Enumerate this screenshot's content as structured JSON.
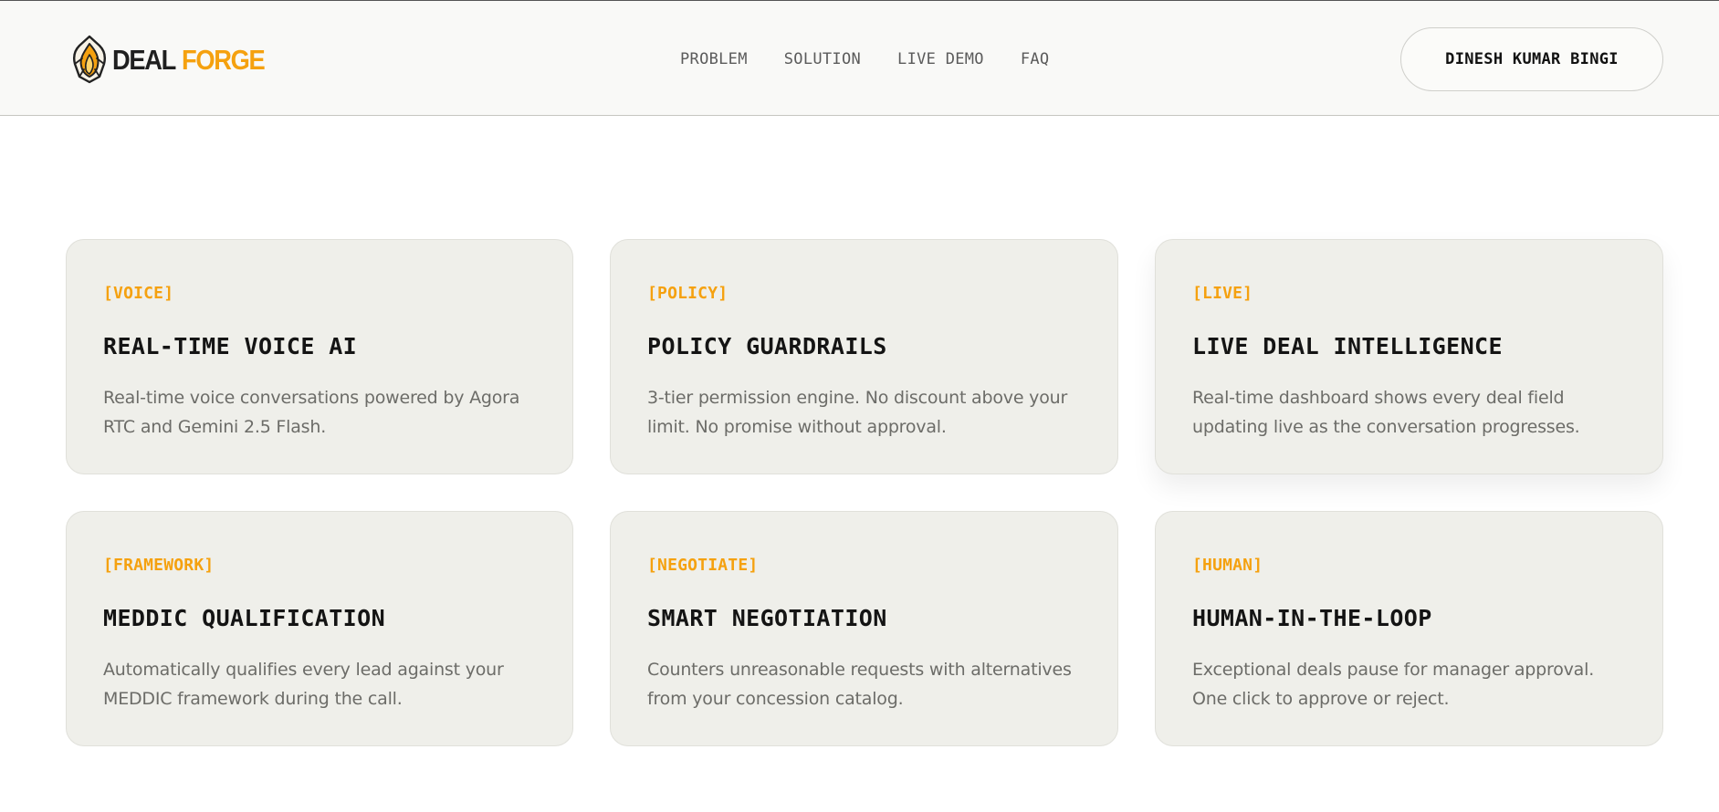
{
  "brand": {
    "word1": "DEAL",
    "word2": "FORGE",
    "logo_icon": "flame-shield-icon",
    "accent_color": "#f5a10f"
  },
  "nav": {
    "items": [
      {
        "label": "PROBLEM"
      },
      {
        "label": "SOLUTION"
      },
      {
        "label": "LIVE DEMO"
      },
      {
        "label": "FAQ"
      }
    ]
  },
  "user": {
    "name": "DINESH KUMAR BINGI"
  },
  "features": [
    {
      "tag": "[VOICE]",
      "title": "REAL-TIME VOICE AI",
      "description": "Real-time voice conversations powered by Agora RTC and Gemini 2.5 Flash."
    },
    {
      "tag": "[POLICY]",
      "title": "POLICY GUARDRAILS",
      "description": "3-tier permission engine. No discount above your limit. No promise without approval."
    },
    {
      "tag": "[LIVE]",
      "title": "LIVE DEAL INTELLIGENCE",
      "description": "Real-time dashboard shows every deal field updating live as the conversation progresses."
    },
    {
      "tag": "[FRAMEWORK]",
      "title": "MEDDIC QUALIFICATION",
      "description": "Automatically qualifies every lead against your MEDDIC framework during the call."
    },
    {
      "tag": "[NEGOTIATE]",
      "title": "SMART NEGOTIATION",
      "description": "Counters unreasonable requests with alternatives from your concession catalog."
    },
    {
      "tag": "[HUMAN]",
      "title": "HUMAN-IN-THE-LOOP",
      "description": "Exceptional deals pause for manager approval. One click to approve or reject."
    }
  ]
}
